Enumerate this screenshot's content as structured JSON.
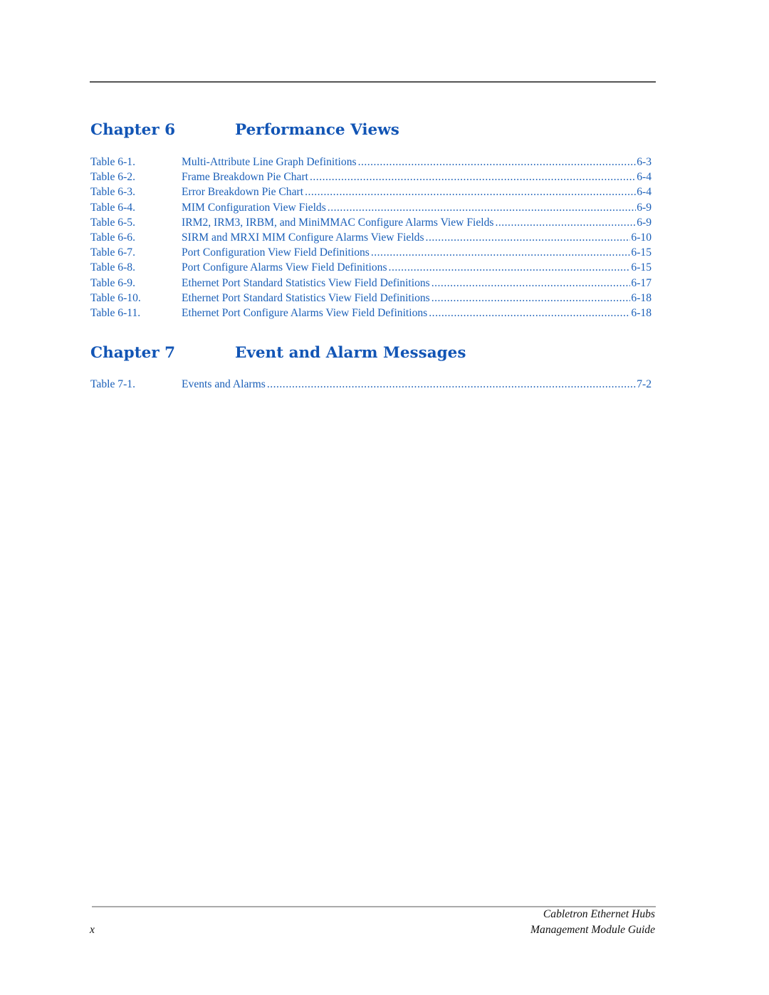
{
  "chapters": [
    {
      "number_label": "Chapter 6",
      "title": "Performance Views",
      "tables": [
        {
          "label": "Table 6-1.",
          "title": "Multi-Attribute Line Graph Definitions",
          "page": "6-3"
        },
        {
          "label": "Table 6-2.",
          "title": "Frame Breakdown Pie Chart",
          "page": "6-4"
        },
        {
          "label": "Table 6-3.",
          "title": "Error Breakdown Pie Chart",
          "page": "6-4"
        },
        {
          "label": "Table 6-4.",
          "title": "MIM Configuration View Fields",
          "page": "6-9"
        },
        {
          "label": "Table 6-5.",
          "title": "IRM2, IRM3, IRBM, and MiniMMAC Configure Alarms View Fields",
          "page": "6-9"
        },
        {
          "label": "Table 6-6.",
          "title": "SIRM and MRXI MIM Configure Alarms View Fields",
          "page": "6-10"
        },
        {
          "label": "Table 6-7.",
          "title": "Port Configuration View Field Definitions",
          "page": "6-15"
        },
        {
          "label": "Table 6-8.",
          "title": "Port Configure Alarms View Field Definitions",
          "page": "6-15"
        },
        {
          "label": "Table 6-9.",
          "title": "Ethernet Port Standard Statistics View Field Definitions",
          "page": "6-17"
        },
        {
          "label": "Table 6-10.",
          "title": "Ethernet Port Standard Statistics View Field Definitions",
          "page": "6-18"
        },
        {
          "label": "Table 6-11.",
          "title": "Ethernet Port Configure Alarms View Field Definitions",
          "page": "6-18"
        }
      ]
    },
    {
      "number_label": "Chapter 7",
      "title": "Event and Alarm Messages",
      "tables": [
        {
          "label": "Table 7-1.",
          "title": "Events and Alarms",
          "page": "7-2"
        }
      ]
    }
  ],
  "footer": {
    "page_number": "x",
    "book_title_line1": "Cabletron Ethernet Hubs",
    "book_title_line2": "Management Module Guide"
  },
  "colors": {
    "heading": "#1255b5",
    "link_text": "#1a5fb8",
    "rule": "#555555"
  }
}
